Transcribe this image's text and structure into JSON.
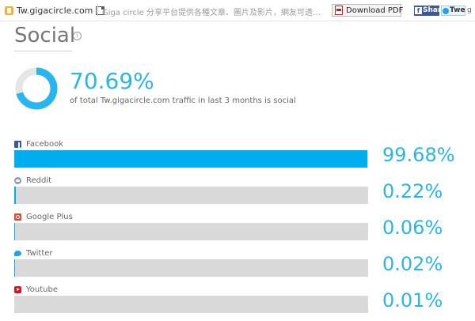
{
  "site_header": {
    "domain": "Tw.gigacircle.com",
    "description": "Giga circle 分享平台提供各種文章、圖片及影片，網友可透…",
    "download_pdf_label": "Download PDF",
    "share_label": "Shar",
    "tweet_label": "Twe",
    "gplus_label": "g"
  },
  "section": {
    "title": "Social",
    "info_icon": "i"
  },
  "summary": {
    "percent_text": "70.69%",
    "percent_value": 70.69,
    "description": "of total Tw.gigacircle.com traffic in last 3 months is social",
    "ring_color": "#29b6f0",
    "ring_track_color": "#e6e6e6"
  },
  "sources": [
    {
      "name": "Facebook",
      "icon": "facebook-icon",
      "percent_text": "99.68%",
      "value": 99.68
    },
    {
      "name": "Reddit",
      "icon": "reddit-icon",
      "percent_text": "0.22%",
      "value": 0.22
    },
    {
      "name": "Google Plus",
      "icon": "google-plus-icon",
      "percent_text": "0.06%",
      "value": 0.06
    },
    {
      "name": "Twitter",
      "icon": "twitter-icon",
      "percent_text": "0.02%",
      "value": 0.02
    },
    {
      "name": "Youtube",
      "icon": "youtube-icon",
      "percent_text": "0.01%",
      "value": 0.01
    }
  ],
  "colors": {
    "accent": "#2ab5e6",
    "bar_fill": "#00aeef",
    "bar_track": "#d9d9d9"
  }
}
